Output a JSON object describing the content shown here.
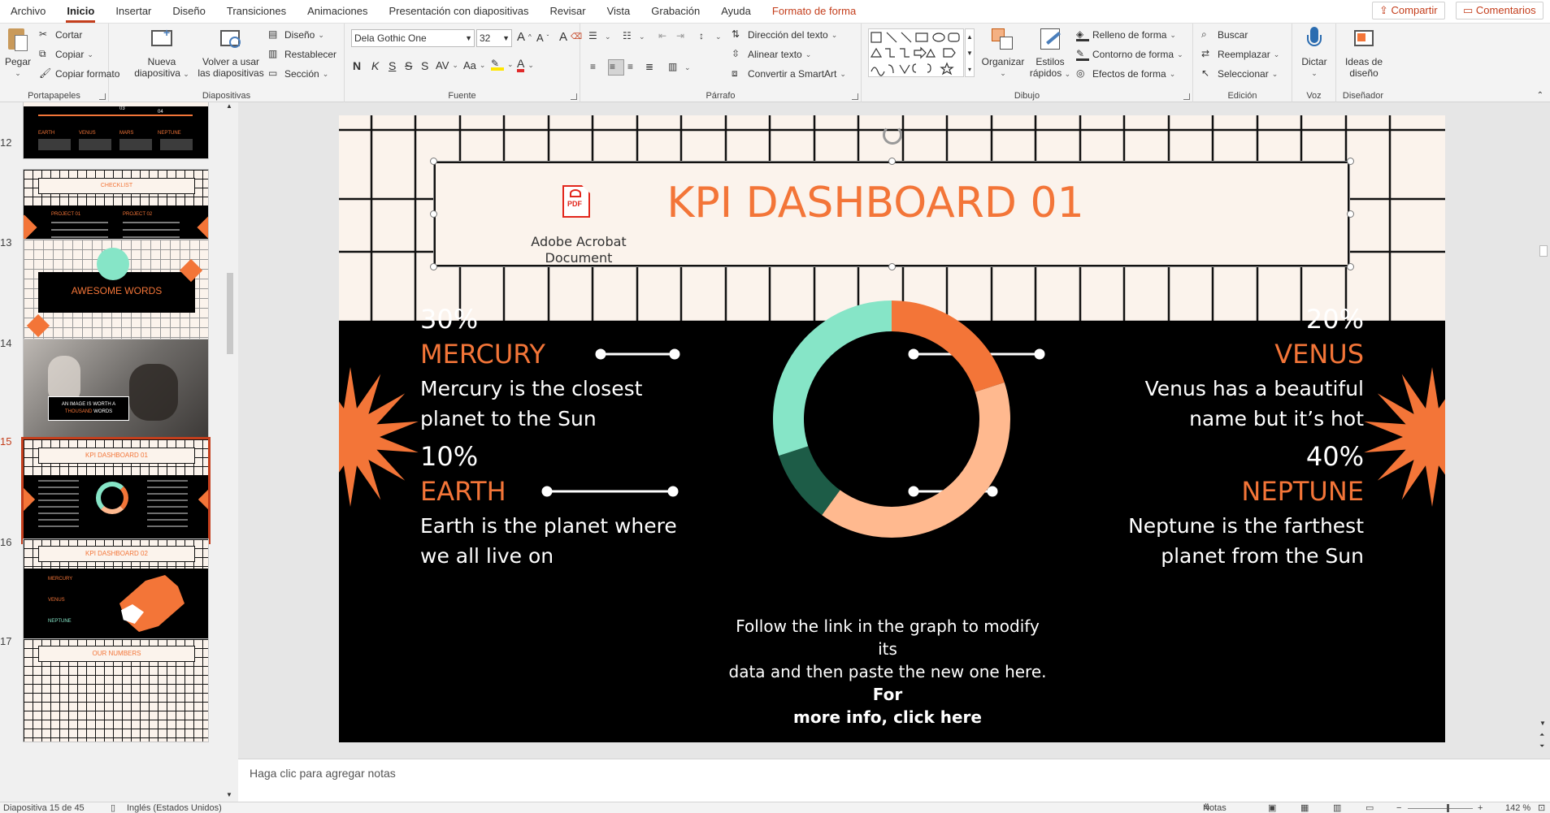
{
  "menu": {
    "tabs": [
      "Archivo",
      "Inicio",
      "Insertar",
      "Diseño",
      "Transiciones",
      "Animaciones",
      "Presentación con diapositivas",
      "Revisar",
      "Vista",
      "Grabación",
      "Ayuda",
      "Formato de forma"
    ],
    "share": "Compartir",
    "comments": "Comentarios"
  },
  "ribbon": {
    "clipboard": {
      "paste": "Pegar",
      "cut": "Cortar",
      "copy": "Copiar",
      "format_painter": "Copiar formato",
      "label": "Portapapeles"
    },
    "slides": {
      "new_slide_line1": "Nueva",
      "new_slide_line2": "diapositiva",
      "reuse_line1": "Volver a usar",
      "reuse_line2": "las diapositivas",
      "layout": "Diseño",
      "reset": "Restablecer",
      "section": "Sección",
      "label": "Diapositivas"
    },
    "font": {
      "family": "Dela Gothic One",
      "size": "32",
      "bold": "N",
      "italic": "K",
      "underline": "S",
      "strike": "S",
      "spacing": "AV",
      "case": "Aa",
      "grow": "A",
      "shrink": "A",
      "clear": "A",
      "label": "Fuente"
    },
    "paragraph": {
      "text_direction": "Dirección del texto",
      "align_text": "Alinear texto",
      "smartart": "Convertir a SmartArt",
      "label": "Párrafo"
    },
    "drawing": {
      "arrange": "Organizar",
      "styles_line1": "Estilos",
      "styles_line2": "rápidos",
      "fill": "Relleno de forma",
      "outline": "Contorno de forma",
      "effects": "Efectos de forma",
      "label": "Dibujo"
    },
    "editing": {
      "find": "Buscar",
      "replace": "Reemplazar",
      "select": "Seleccionar",
      "label": "Edición"
    },
    "voice": {
      "dictate": "Dictar",
      "label": "Voz"
    },
    "designer": {
      "ideas_line1": "Ideas de",
      "ideas_line2": "diseño",
      "label": "Diseñador"
    }
  },
  "thumbnails": [
    {
      "num": "",
      "caption": "",
      "planets": [
        "EARTH",
        "VENUS",
        "MARS",
        "NEPTUNE"
      ],
      "nums": [
        "03",
        "04"
      ]
    },
    {
      "num": "12",
      "caption": "CHECKLIST",
      "cols": [
        "PROJECT 01",
        "PROJECT 02"
      ]
    },
    {
      "num": "13",
      "caption": "AWESOME WORDS"
    },
    {
      "num": "14",
      "caption_line1": "AN IMAGE IS WORTH A",
      "caption_line2": "THOUSAND",
      "caption_line3": "WORDS"
    },
    {
      "num": "15",
      "caption": "KPI DASHBOARD 01"
    },
    {
      "num": "16",
      "caption": "KPI DASHBOARD 02",
      "items": [
        "MERCURY",
        "VENUS",
        "NEPTUNE"
      ]
    },
    {
      "num": "17",
      "caption": "OUR NUMBERS"
    }
  ],
  "slide": {
    "title": "KPI DASHBOARD 01",
    "pdf_icon": "PDF",
    "pdf_label_line1": "Adobe Acrobat",
    "pdf_label_line2": "Document",
    "left_top": {
      "pct": "30%",
      "name": "MERCURY",
      "desc_line1": "Mercury is the closest",
      "desc_line2": "planet to the Sun"
    },
    "left_bottom": {
      "pct": "10%",
      "name": "EARTH",
      "desc_line1": "Earth is the planet where",
      "desc_line2": "we all live on"
    },
    "right_top": {
      "pct": "20%",
      "name": "VENUS",
      "desc_line1": "Venus has a beautiful",
      "desc_line2": "name but it’s hot"
    },
    "right_bottom": {
      "pct": "40%",
      "name": "NEPTUNE",
      "desc_line1": "Neptune is the farthest",
      "desc_line2": "planet from the Sun"
    },
    "info_line1": "Follow the link in the graph to modify its",
    "info_line2": "data and then paste the new one here.",
    "info_bold_line1": "For",
    "info_bold_line2": "more info, click here"
  },
  "chart_data": {
    "type": "pie",
    "categories": [
      "VENUS",
      "NEPTUNE",
      "EARTH",
      "MERCURY"
    ],
    "values": [
      20,
      40,
      10,
      30
    ],
    "colors": [
      "#f37538",
      "#ffb98f",
      "#1d5c47",
      "#86e5c7"
    ]
  },
  "notes": {
    "placeholder": "Haga clic para agregar notas"
  },
  "status": {
    "slide": "Diapositiva 15 de 45",
    "language": "Inglés (Estados Unidos)",
    "notes": "Notas",
    "zoom": "142 %"
  },
  "colors": {
    "accent": "#c43e1c",
    "orange": "#f37538",
    "cream": "#fbf3ec"
  }
}
